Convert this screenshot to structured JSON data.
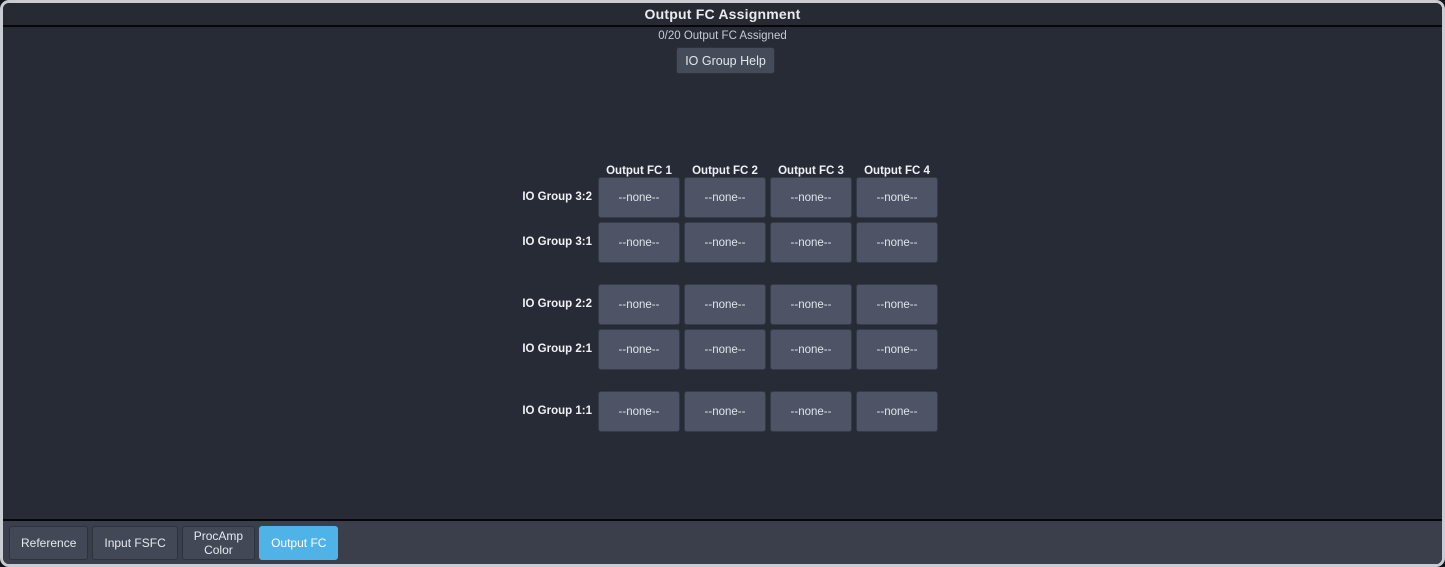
{
  "window": {
    "title": "Output FC Assignment"
  },
  "header": {
    "assigned_count": "0/20 Output FC Assigned",
    "help_button": "IO Group Help"
  },
  "matrix": {
    "columns": [
      {
        "label": "Output FC 1"
      },
      {
        "label": "Output FC 2"
      },
      {
        "label": "Output FC 3"
      },
      {
        "label": "Output FC 4"
      }
    ],
    "groups": [
      {
        "rows": [
          {
            "label": "IO Group 3:2",
            "cells": [
              "--none--",
              "--none--",
              "--none--",
              "--none--"
            ]
          },
          {
            "label": "IO Group 3:1",
            "cells": [
              "--none--",
              "--none--",
              "--none--",
              "--none--"
            ]
          }
        ]
      },
      {
        "rows": [
          {
            "label": "IO Group 2:2",
            "cells": [
              "--none--",
              "--none--",
              "--none--",
              "--none--"
            ]
          },
          {
            "label": "IO Group 2:1",
            "cells": [
              "--none--",
              "--none--",
              "--none--",
              "--none--"
            ]
          }
        ]
      },
      {
        "rows": [
          {
            "label": "IO Group 1:1",
            "cells": [
              "--none--",
              "--none--",
              "--none--",
              "--none--"
            ]
          }
        ]
      }
    ]
  },
  "tabs": [
    {
      "label": "Reference",
      "active": false
    },
    {
      "label": "Input FSFC",
      "active": false
    },
    {
      "label": "ProcAmp\nColor",
      "active": false
    },
    {
      "label": "Output FC",
      "active": true
    }
  ],
  "colors": {
    "window_background": "#272b35",
    "titlebar": "#262a33",
    "cell_fill": "#4e5466",
    "accent_active_tab": "#4fb3e8",
    "tabbar": "#3a3f4b",
    "button_fill": "#454b59",
    "text_primary": "#e8ebef"
  }
}
